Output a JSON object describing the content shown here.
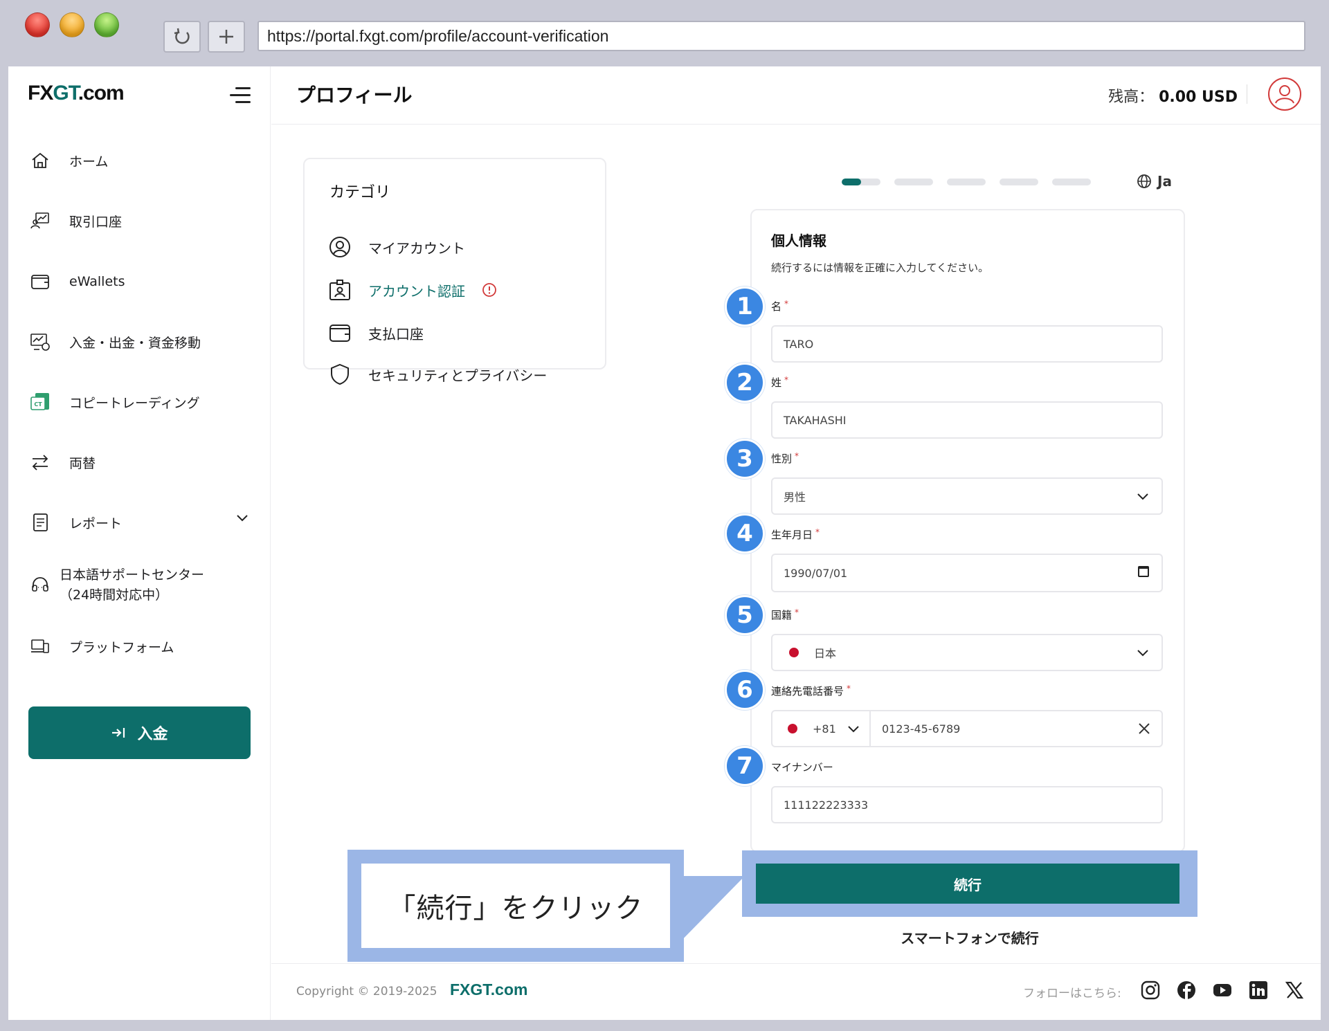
{
  "browser": {
    "url": "https://portal.fxgt.com/profile/account-verification"
  },
  "logo": {
    "text_prefix": "FX",
    "text_mid": "GT",
    "text_suffix": ".com"
  },
  "sidebar": {
    "items": [
      {
        "label": "ホーム",
        "icon": "home-icon"
      },
      {
        "label": "取引口座",
        "icon": "trading-account-icon"
      },
      {
        "label": "eWallets",
        "icon": "wallet-icon"
      },
      {
        "label": "入金・出金・資金移動",
        "icon": "transfer-money-icon"
      },
      {
        "label": "コピートレーディング",
        "icon": "copy-trading-icon"
      },
      {
        "label": "両替",
        "icon": "exchange-icon"
      },
      {
        "label": "レポート",
        "icon": "report-icon"
      },
      {
        "label": "日本語サポートセンター",
        "label2": "（24時間対応中）",
        "icon": "support-headset-icon"
      },
      {
        "label": "プラットフォーム",
        "icon": "platform-icon"
      }
    ],
    "deposit_button": "入金"
  },
  "header": {
    "title": "プロフィール",
    "balance_label": "残高：",
    "balance_value": "0.00 USD"
  },
  "categories": {
    "title": "カテゴリ",
    "items": [
      {
        "label": "マイアカウント",
        "icon": "user-circle-icon"
      },
      {
        "label": "アカウント認証",
        "icon": "id-card-icon",
        "active": true
      },
      {
        "label": "支払口座",
        "icon": "wallet-icon"
      },
      {
        "label": "セキュリティとプライバシー",
        "icon": "shield-icon"
      }
    ]
  },
  "progress": {
    "steps": 5,
    "current": 1,
    "fill_fraction": 0.5
  },
  "language": "Ja",
  "form": {
    "title": "個人情報",
    "subtitle": "続行するには情報を正確に入力してください。",
    "fields": [
      {
        "label": "名",
        "required": true,
        "value": "TARO"
      },
      {
        "label": "姓",
        "required": true,
        "value": "TAKAHASHI"
      },
      {
        "label": "性別",
        "required": true,
        "value": "男性"
      },
      {
        "label": "生年月日",
        "required": true,
        "value": "1990/07/01"
      },
      {
        "label": "国籍",
        "required": true,
        "value": "日本"
      },
      {
        "label": "連絡先電話番号",
        "required": true,
        "code": "+81",
        "value": "0123-45-6789"
      },
      {
        "label": "マイナンバー",
        "required": false,
        "value": "111122223333"
      }
    ],
    "required_mark": "*",
    "continue_button": "続行",
    "smartphone_link": "スマートフォンで続行"
  },
  "badges": [
    "1",
    "2",
    "3",
    "4",
    "5",
    "6",
    "7"
  ],
  "callout": "「続行」をクリック",
  "footer": {
    "copyright": "Copyright © 2019-2025",
    "brand": "FXGT.com",
    "follow_label": "フォローはこちら:"
  },
  "colors": {
    "brand": "#0d6e6a",
    "badge": "#3b87e2",
    "callout": "#9bb6e6",
    "alert": "#d23a3a"
  }
}
